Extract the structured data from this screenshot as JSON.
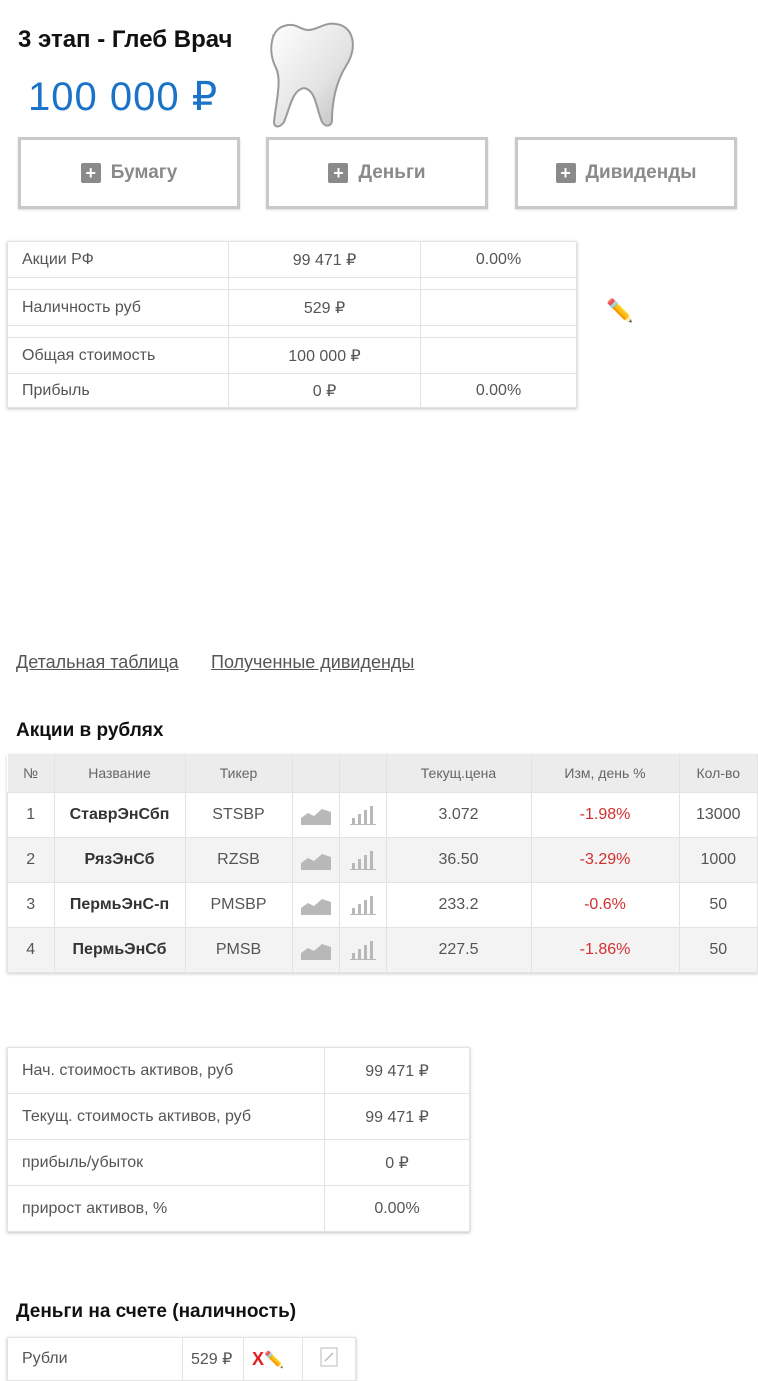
{
  "header": {
    "title": "3 этап - Глеб Врач",
    "amount": "100 000 ₽"
  },
  "buttons": {
    "paper": "Бумагу",
    "money": "Деньги",
    "dividends": "Дивиденды"
  },
  "summary": [
    {
      "label": "Акции РФ",
      "value": "99 471 ₽",
      "pct": "0.00%"
    },
    {
      "label": "Наличность руб",
      "value": "529 ₽",
      "pct": ""
    },
    {
      "label": "Общая стоимость",
      "value": "100 000 ₽",
      "pct": ""
    },
    {
      "label": "Прибыль",
      "value": "0 ₽",
      "pct": "0.00%"
    }
  ],
  "links": {
    "detail_table": "Детальная таблица",
    "received_dividends": "Полученные дивиденды"
  },
  "stocks_section": {
    "title": "Акции в рублях",
    "headers": [
      "№",
      "Название",
      "Тикер",
      "",
      "",
      "Текущ.цена",
      "Изм, день %",
      "Кол-во"
    ],
    "rows": [
      {
        "n": "1",
        "name": "СтаврЭнСбп",
        "ticker": "STSBP",
        "price": "3.072",
        "change": "-1.98%",
        "qty": "13000"
      },
      {
        "n": "2",
        "name": "РязЭнСб",
        "ticker": "RZSB",
        "price": "36.50",
        "change": "-3.29%",
        "qty": "1000"
      },
      {
        "n": "3",
        "name": "ПермьЭнС-п",
        "ticker": "PMSBP",
        "price": "233.2",
        "change": "-0.6%",
        "qty": "50"
      },
      {
        "n": "4",
        "name": "ПермьЭнСб",
        "ticker": "PMSB",
        "price": "227.5",
        "change": "-1.86%",
        "qty": "50"
      }
    ]
  },
  "assets": [
    {
      "label": "Нач. стоимость активов, руб",
      "value": "99 471 ₽"
    },
    {
      "label": "Текущ. стоимость активов, руб",
      "value": "99 471 ₽"
    },
    {
      "label": "прибыль/убыток",
      "value": "0 ₽"
    },
    {
      "label": "прирост активов, %",
      "value": "0.00%"
    }
  ],
  "cash_section": {
    "title": "Деньги на счете (наличность)",
    "label": "Рубли",
    "value": "529 ₽",
    "delete": "X"
  },
  "colors": {
    "amount": "#1a73c8",
    "negative": "#d32f2f",
    "header_bg": "#ececec"
  }
}
